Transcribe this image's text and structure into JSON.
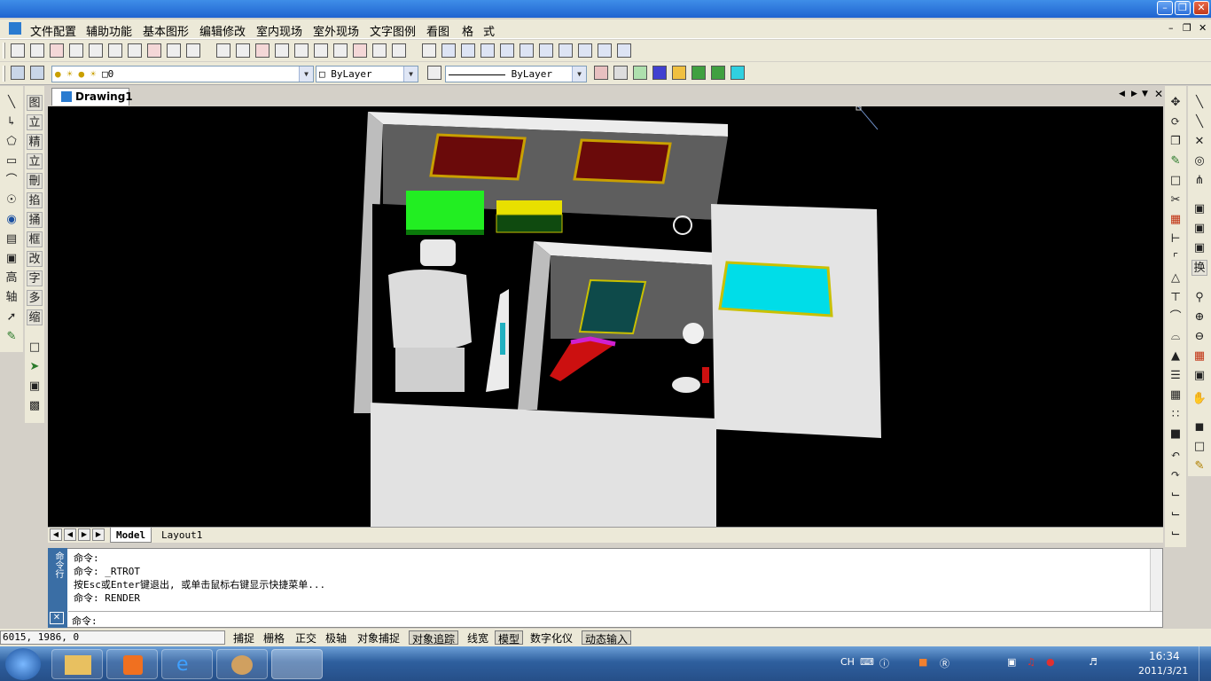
{
  "menu": {
    "items": [
      "文件配置",
      "辅助功能",
      "基本图形",
      "编辑修改",
      "室内现场",
      "室外现场",
      "文字图例",
      "看图",
      "格",
      "式"
    ]
  },
  "layers": {
    "current_layer": "0",
    "color": "ByLayer",
    "linetype": "ByLayer"
  },
  "left_toolbar": {
    "glyphs": [
      "图",
      "立",
      "精",
      "立",
      "刪",
      "掐",
      "捅",
      "框",
      "改",
      "字",
      "高",
      "多",
      "轴",
      "缩"
    ]
  },
  "right_toolbar": {
    "glyph": "换"
  },
  "document": {
    "tab": "Drawing1"
  },
  "layout_tabs": [
    "Model",
    "Layout1"
  ],
  "command": {
    "side_label": "命令行",
    "history": [
      "命令:",
      "命令: _RTROT",
      "按Esc或Enter键退出, 或单击鼠标右键显示快捷菜单...",
      "命令: RENDER"
    ],
    "prompt": "命令:"
  },
  "status": {
    "coordinates": "6015, 1986, 0",
    "buttons": [
      "捕捉",
      "栅格",
      "正交",
      "极轴",
      "对象捕捉",
      "对象追踪",
      "线宽",
      "模型",
      "数字化仪",
      "动态输入"
    ],
    "active": [
      "对象追踪",
      "模型",
      "动态输入"
    ]
  },
  "taskbar": {
    "ime": "CH",
    "time": "16:34",
    "date": "2011/3/21"
  },
  "colors": {
    "title_bar": "#1f63d0",
    "viewport_bg": "#000000",
    "taskbar": "#2e5f9e"
  }
}
